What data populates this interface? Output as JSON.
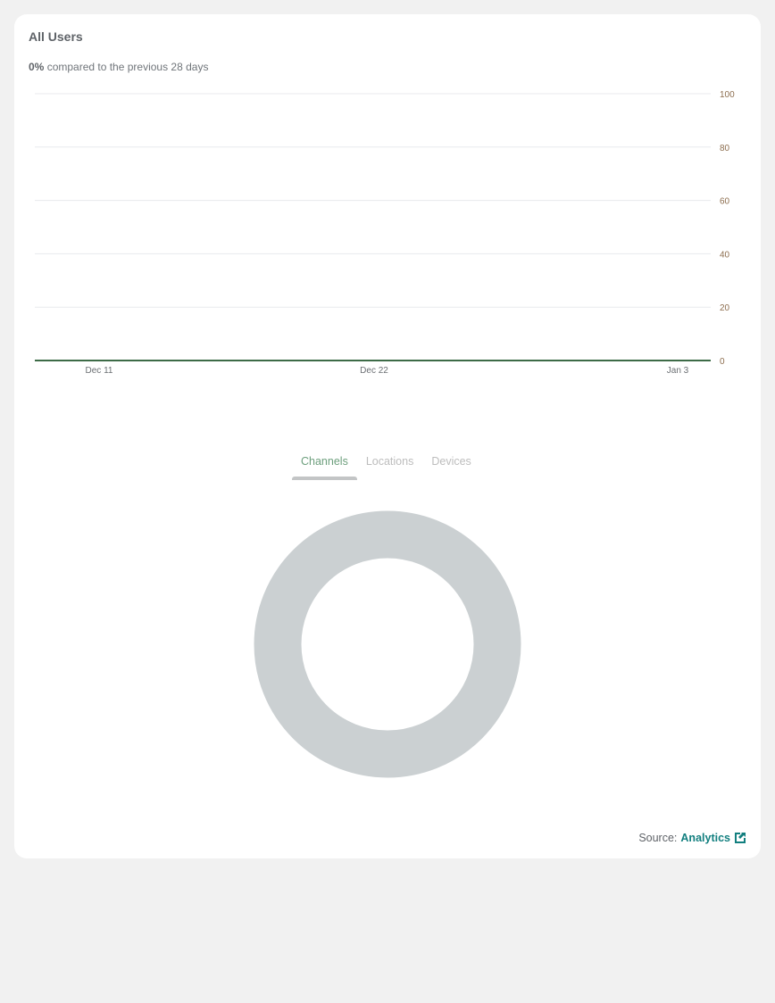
{
  "card": {
    "title": "All Users",
    "change_value": "0%",
    "change_text": "compared to the previous 28 days"
  },
  "chart_data": {
    "type": "line",
    "x_ticks": [
      "Dec 11",
      "Dec 22",
      "Jan 3"
    ],
    "y_ticks": [
      "0",
      "20",
      "40",
      "60",
      "80",
      "100"
    ],
    "ylim": [
      0,
      100
    ],
    "series": [
      {
        "name": "All Users",
        "values": [
          0,
          0
        ],
        "color": "#3d6b47"
      }
    ],
    "grid": true
  },
  "tabs": [
    {
      "label": "Channels",
      "active": true
    },
    {
      "label": "Locations",
      "active": false
    },
    {
      "label": "Devices",
      "active": false
    }
  ],
  "donut": {
    "empty_color": "#cbd0d2"
  },
  "footer": {
    "source_label": "Source:",
    "link_label": "Analytics",
    "icon": "external-link-icon"
  }
}
